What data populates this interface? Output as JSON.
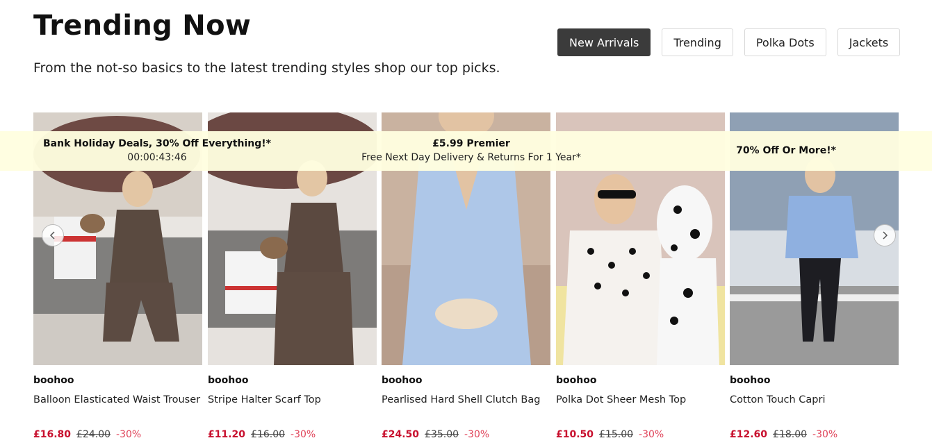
{
  "header": {
    "title": "Trending Now",
    "subtitle": "From the not-so basics to the latest trending styles shop our top picks."
  },
  "tabs": [
    {
      "label": "New Arrivals",
      "active": true
    },
    {
      "label": "Trending",
      "active": false
    },
    {
      "label": "Polka Dots",
      "active": false
    },
    {
      "label": "Jackets",
      "active": false
    }
  ],
  "promo": {
    "items": [
      {
        "headline": "Bank Holiday Deals, 30% Off Everything!*",
        "sub": "00:00:43:46"
      },
      {
        "headline": "£5.99 Premier",
        "sub": "Free Next Day Delivery & Returns For 1 Year*"
      },
      {
        "headline": "70% Off Or More!*"
      }
    ]
  },
  "products": [
    {
      "brand": "boohoo",
      "name": "Balloon Elasticated Waist Trouser",
      "price": "£16.80",
      "was": "£24.00",
      "discount": "-30%"
    },
    {
      "brand": "boohoo",
      "name": "Stripe Halter Scarf Top",
      "price": "£11.20",
      "was": "£16.00",
      "discount": "-30%"
    },
    {
      "brand": "boohoo",
      "name": "Pearlised Hard Shell Clutch Bag",
      "price": "£24.50",
      "was": "£35.00",
      "discount": "-30%"
    },
    {
      "brand": "boohoo",
      "name": "Polka Dot Sheer Mesh Top",
      "price": "£10.50",
      "was": "£15.00",
      "discount": "-30%"
    },
    {
      "brand": "boohoo",
      "name": "Cotton Touch Capri",
      "price": "£12.60",
      "was": "£18.00",
      "discount": "-30%"
    }
  ],
  "carousel": {
    "prev_icon": "chevron-left-icon",
    "next_icon": "chevron-right-icon"
  },
  "colors": {
    "price_now": "#c8102e",
    "discount": "#e0445a",
    "promo_bg": "#fffee0",
    "active_tab_bg": "#3b3b3b"
  }
}
